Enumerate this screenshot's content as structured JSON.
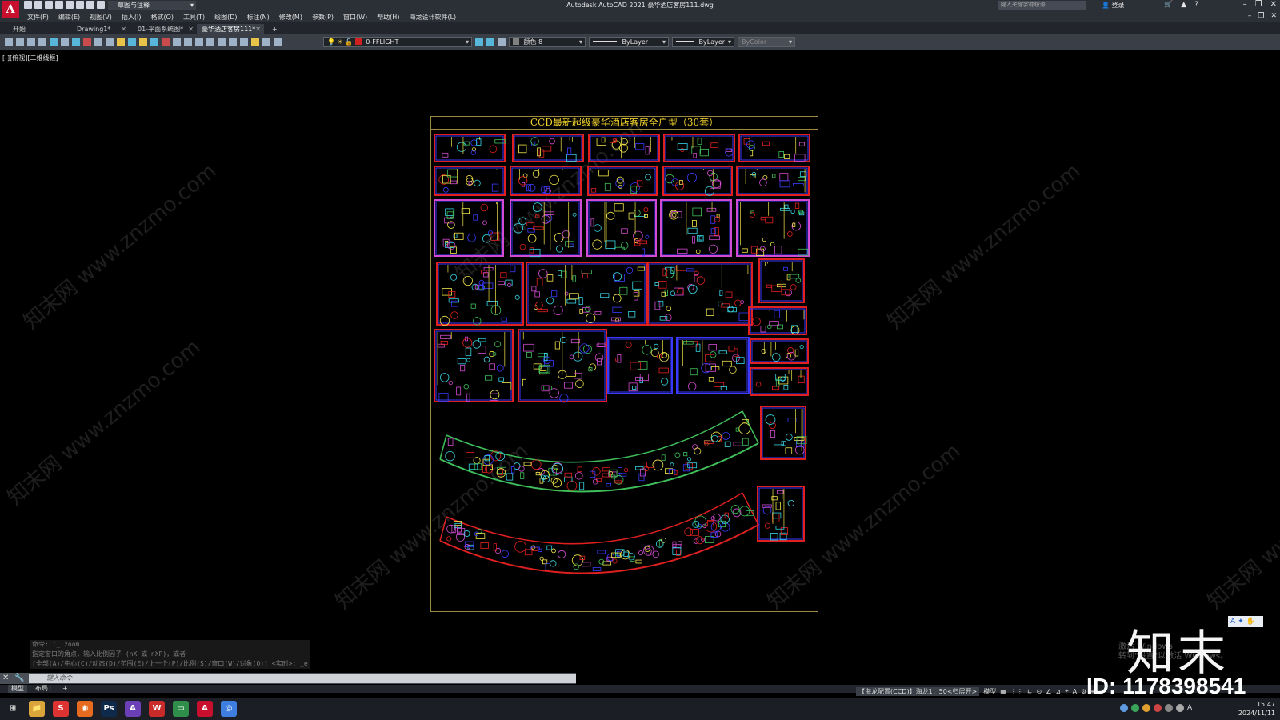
{
  "app": {
    "logo": "A",
    "title": "Autodesk AutoCAD 2021    豪华酒店客房111.dwg",
    "workspace": "草图与注释",
    "search_placeholder": "键入关键字或短语",
    "signin": "登录"
  },
  "menu": [
    "文件(F)",
    "编辑(E)",
    "视图(V)",
    "插入(I)",
    "格式(O)",
    "工具(T)",
    "绘图(D)",
    "标注(N)",
    "修改(M)",
    "参数(P)",
    "窗口(W)",
    "帮助(H)",
    "海龙设计软件(L)"
  ],
  "tabs": [
    {
      "label": "开始",
      "closable": false
    },
    {
      "label": "Drawing1*",
      "closable": true
    },
    {
      "label": "01-平面系统图*",
      "closable": true
    },
    {
      "label": "豪华酒店客房111*",
      "closable": true,
      "active": true
    }
  ],
  "tab_add": "+",
  "toolbar": {
    "layer": "0-FFLIGHT",
    "layer_color": "#d02020",
    "color": "颜色 8",
    "linetype": "ByLayer",
    "lineweight": "ByLayer",
    "plotstyle": "ByColor"
  },
  "viewport_label": "[-][俯视][二维线框]",
  "drawing": {
    "title": "CCD最新超级豪华酒店客房全户型（30套）",
    "frame_color": "#9c8b3c",
    "title_color": "#f0d12b"
  },
  "watermark": "知末网 www.znzmo.com",
  "command": {
    "history": [
      "命令: '_.zoom",
      "指定窗口的角点，输入比例因子 (nX 或 nXP)，或者",
      "[全部(A)/中心(C)/动态(D)/范围(E)/上一个(P)/比例(S)/窗口(W)/对象(O)] <实时>: _e"
    ],
    "placeholder": "键入命令"
  },
  "layout_tabs": [
    "模型",
    "布局1",
    "+"
  ],
  "status": {
    "annotation": "【海龙配置(CCD)】海龙1：50<归层开>",
    "model": "模型",
    "items": [
      "▦",
      "⋮⋮",
      "∟",
      "⊙",
      "∠",
      "⊿",
      "⌖",
      "A",
      "⚙",
      "≡"
    ]
  },
  "brand": {
    "name": "知末",
    "id": "ID: 1178398541"
  },
  "windows_activation": [
    "激活 Windows",
    "转到\"设置\"以激活 Windows。"
  ],
  "ime": [
    "A",
    "✦",
    "✋"
  ],
  "taskbar": {
    "apps": [
      {
        "name": "start",
        "label": "⊞",
        "color": "#1b1e24"
      },
      {
        "name": "explorer",
        "label": "📁",
        "color": "#d9a53a"
      },
      {
        "name": "wps",
        "label": "S",
        "color": "#d33"
      },
      {
        "name": "firefox",
        "label": "◉",
        "color": "#e66b1f"
      },
      {
        "name": "photoshop",
        "label": "Ps",
        "color": "#0d2a4a"
      },
      {
        "name": "app-a",
        "label": "A",
        "color": "#6b3fb5"
      },
      {
        "name": "wps-w",
        "label": "W",
        "color": "#c92a2a"
      },
      {
        "name": "terminal",
        "label": "▭",
        "color": "#2f8f4a"
      },
      {
        "name": "autocad",
        "label": "A",
        "color": "#c8102e"
      },
      {
        "name": "chrome",
        "label": "◎",
        "color": "#3e7ee0"
      }
    ],
    "time": "15:47",
    "date": "2024/11/11",
    "lang": "A"
  },
  "colors": {
    "bg": "#000000",
    "chrome": "#2b2f36",
    "toolbar": "#3a3f47",
    "plan_yellow": "#f2e64a",
    "plan_red": "#e02020",
    "plan_blue": "#3a3aff",
    "plan_magenta": "#d24bd2",
    "plan_cyan": "#38d7e6",
    "plan_green": "#3fbf5a"
  }
}
